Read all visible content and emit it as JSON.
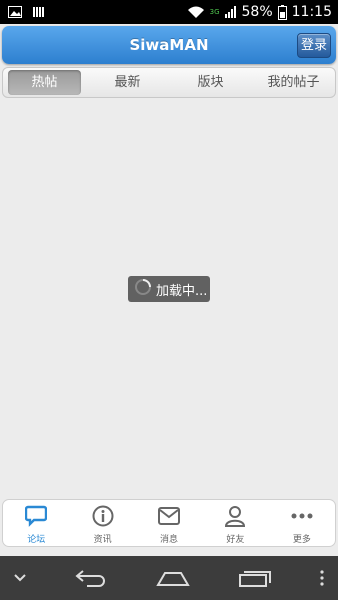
{
  "status_bar": {
    "network_label": "3G",
    "battery": "58%",
    "time": "11:15",
    "icons": [
      "image-icon",
      "sim-icon",
      "wifi-icon",
      "signal-icon",
      "battery-icon"
    ]
  },
  "header": {
    "title": "SiwaMAN",
    "login_label": "登录",
    "color": "#3a8fdc"
  },
  "tabs": [
    {
      "label": "热帖",
      "active": true
    },
    {
      "label": "最新",
      "active": false
    },
    {
      "label": "版块",
      "active": false
    },
    {
      "label": "我的帖子",
      "active": false
    }
  ],
  "loading": {
    "text": "加载中..."
  },
  "bottom_nav": [
    {
      "label": "论坛",
      "icon": "chat-bubble-icon",
      "active": true
    },
    {
      "label": "资讯",
      "icon": "info-icon",
      "active": false
    },
    {
      "label": "消息",
      "icon": "mail-icon",
      "active": false
    },
    {
      "label": "好友",
      "icon": "person-icon",
      "active": false
    },
    {
      "label": "更多",
      "icon": "more-icon",
      "active": false
    }
  ],
  "system_nav": {
    "icons": [
      "chevron-down-icon",
      "back-icon",
      "home-icon",
      "recents-icon",
      "menu-icon"
    ]
  }
}
